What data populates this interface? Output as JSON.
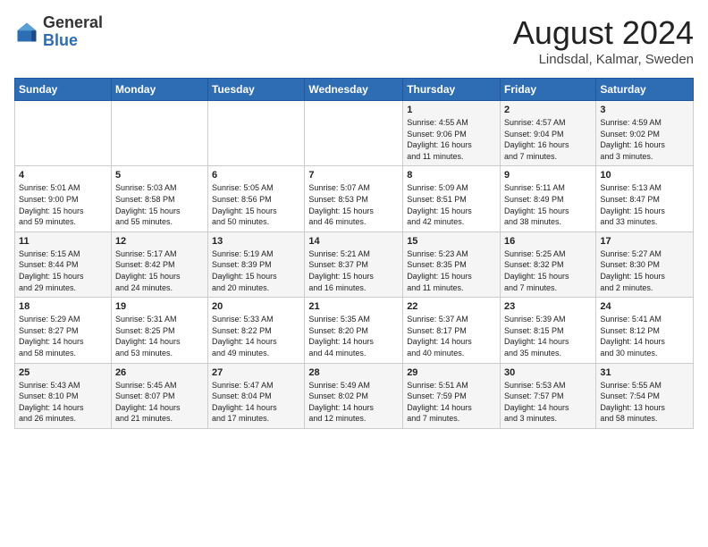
{
  "logo": {
    "general": "General",
    "blue": "Blue"
  },
  "header": {
    "month_year": "August 2024",
    "location": "Lindsdal, Kalmar, Sweden"
  },
  "days_of_week": [
    "Sunday",
    "Monday",
    "Tuesday",
    "Wednesday",
    "Thursday",
    "Friday",
    "Saturday"
  ],
  "weeks": [
    [
      {
        "day": "",
        "info": ""
      },
      {
        "day": "",
        "info": ""
      },
      {
        "day": "",
        "info": ""
      },
      {
        "day": "",
        "info": ""
      },
      {
        "day": "1",
        "info": "Sunrise: 4:55 AM\nSunset: 9:06 PM\nDaylight: 16 hours\nand 11 minutes."
      },
      {
        "day": "2",
        "info": "Sunrise: 4:57 AM\nSunset: 9:04 PM\nDaylight: 16 hours\nand 7 minutes."
      },
      {
        "day": "3",
        "info": "Sunrise: 4:59 AM\nSunset: 9:02 PM\nDaylight: 16 hours\nand 3 minutes."
      }
    ],
    [
      {
        "day": "4",
        "info": "Sunrise: 5:01 AM\nSunset: 9:00 PM\nDaylight: 15 hours\nand 59 minutes."
      },
      {
        "day": "5",
        "info": "Sunrise: 5:03 AM\nSunset: 8:58 PM\nDaylight: 15 hours\nand 55 minutes."
      },
      {
        "day": "6",
        "info": "Sunrise: 5:05 AM\nSunset: 8:56 PM\nDaylight: 15 hours\nand 50 minutes."
      },
      {
        "day": "7",
        "info": "Sunrise: 5:07 AM\nSunset: 8:53 PM\nDaylight: 15 hours\nand 46 minutes."
      },
      {
        "day": "8",
        "info": "Sunrise: 5:09 AM\nSunset: 8:51 PM\nDaylight: 15 hours\nand 42 minutes."
      },
      {
        "day": "9",
        "info": "Sunrise: 5:11 AM\nSunset: 8:49 PM\nDaylight: 15 hours\nand 38 minutes."
      },
      {
        "day": "10",
        "info": "Sunrise: 5:13 AM\nSunset: 8:47 PM\nDaylight: 15 hours\nand 33 minutes."
      }
    ],
    [
      {
        "day": "11",
        "info": "Sunrise: 5:15 AM\nSunset: 8:44 PM\nDaylight: 15 hours\nand 29 minutes."
      },
      {
        "day": "12",
        "info": "Sunrise: 5:17 AM\nSunset: 8:42 PM\nDaylight: 15 hours\nand 24 minutes."
      },
      {
        "day": "13",
        "info": "Sunrise: 5:19 AM\nSunset: 8:39 PM\nDaylight: 15 hours\nand 20 minutes."
      },
      {
        "day": "14",
        "info": "Sunrise: 5:21 AM\nSunset: 8:37 PM\nDaylight: 15 hours\nand 16 minutes."
      },
      {
        "day": "15",
        "info": "Sunrise: 5:23 AM\nSunset: 8:35 PM\nDaylight: 15 hours\nand 11 minutes."
      },
      {
        "day": "16",
        "info": "Sunrise: 5:25 AM\nSunset: 8:32 PM\nDaylight: 15 hours\nand 7 minutes."
      },
      {
        "day": "17",
        "info": "Sunrise: 5:27 AM\nSunset: 8:30 PM\nDaylight: 15 hours\nand 2 minutes."
      }
    ],
    [
      {
        "day": "18",
        "info": "Sunrise: 5:29 AM\nSunset: 8:27 PM\nDaylight: 14 hours\nand 58 minutes."
      },
      {
        "day": "19",
        "info": "Sunrise: 5:31 AM\nSunset: 8:25 PM\nDaylight: 14 hours\nand 53 minutes."
      },
      {
        "day": "20",
        "info": "Sunrise: 5:33 AM\nSunset: 8:22 PM\nDaylight: 14 hours\nand 49 minutes."
      },
      {
        "day": "21",
        "info": "Sunrise: 5:35 AM\nSunset: 8:20 PM\nDaylight: 14 hours\nand 44 minutes."
      },
      {
        "day": "22",
        "info": "Sunrise: 5:37 AM\nSunset: 8:17 PM\nDaylight: 14 hours\nand 40 minutes."
      },
      {
        "day": "23",
        "info": "Sunrise: 5:39 AM\nSunset: 8:15 PM\nDaylight: 14 hours\nand 35 minutes."
      },
      {
        "day": "24",
        "info": "Sunrise: 5:41 AM\nSunset: 8:12 PM\nDaylight: 14 hours\nand 30 minutes."
      }
    ],
    [
      {
        "day": "25",
        "info": "Sunrise: 5:43 AM\nSunset: 8:10 PM\nDaylight: 14 hours\nand 26 minutes."
      },
      {
        "day": "26",
        "info": "Sunrise: 5:45 AM\nSunset: 8:07 PM\nDaylight: 14 hours\nand 21 minutes."
      },
      {
        "day": "27",
        "info": "Sunrise: 5:47 AM\nSunset: 8:04 PM\nDaylight: 14 hours\nand 17 minutes."
      },
      {
        "day": "28",
        "info": "Sunrise: 5:49 AM\nSunset: 8:02 PM\nDaylight: 14 hours\nand 12 minutes."
      },
      {
        "day": "29",
        "info": "Sunrise: 5:51 AM\nSunset: 7:59 PM\nDaylight: 14 hours\nand 7 minutes."
      },
      {
        "day": "30",
        "info": "Sunrise: 5:53 AM\nSunset: 7:57 PM\nDaylight: 14 hours\nand 3 minutes."
      },
      {
        "day": "31",
        "info": "Sunrise: 5:55 AM\nSunset: 7:54 PM\nDaylight: 13 hours\nand 58 minutes."
      }
    ]
  ]
}
